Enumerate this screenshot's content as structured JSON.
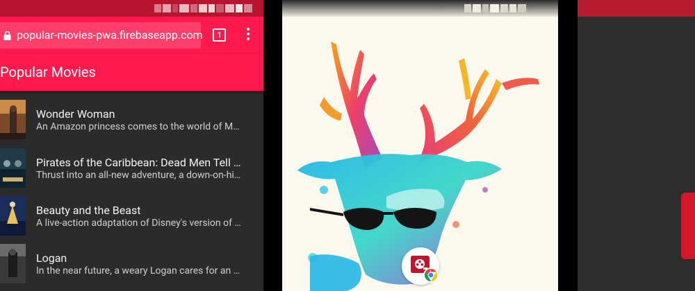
{
  "left_screen": {
    "url": "popular-movies-pwa.firebaseapp.com",
    "tab_count": "1",
    "app_title": "Popular Movies",
    "movies": [
      {
        "title": "Wonder Woman",
        "description": "An Amazon princess comes to the world of Man..."
      },
      {
        "title": "Pirates of the Caribbean: Dead Men Tell N...",
        "description": "Thrust into an all-new adventure, a down-on-his-l..."
      },
      {
        "title": "Beauty and the Beast",
        "description": "A live-action adaptation of Disney's version of th..."
      },
      {
        "title": "Logan",
        "description": "In the near future, a weary Logan cares for an ail..."
      }
    ]
  },
  "colors": {
    "primary": "#ff1a4d",
    "status_bar": "#b7152f",
    "list_background": "#2b2b2b",
    "wallpaper_background": "#fbf8ee"
  },
  "icons": [
    "lock-icon",
    "tabs-icon",
    "overflow-menu-icon",
    "movie-reel-icon",
    "chrome-icon"
  ]
}
